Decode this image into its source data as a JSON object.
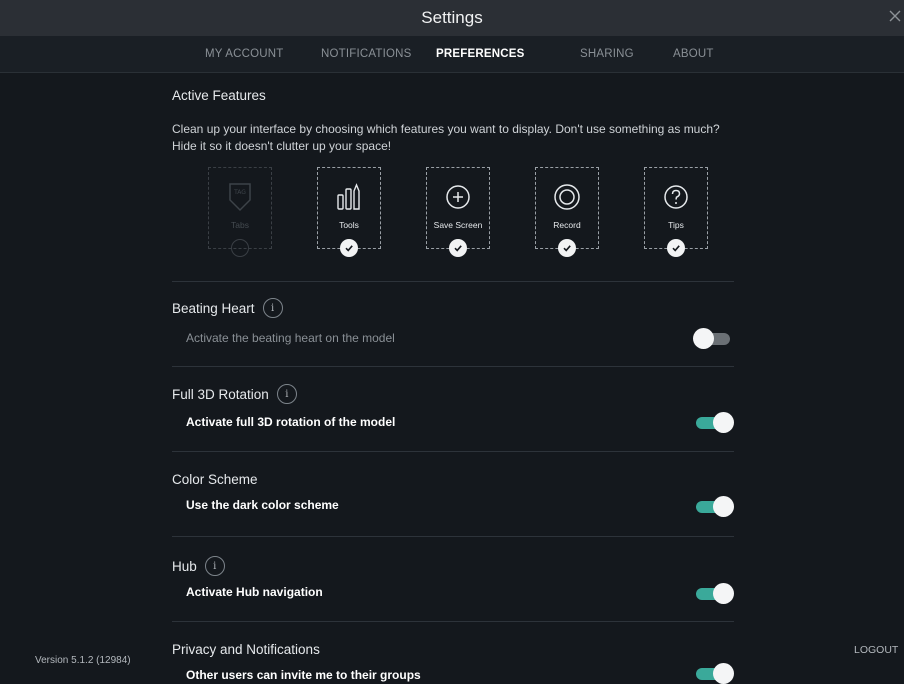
{
  "window": {
    "title": "Settings"
  },
  "tabs": [
    {
      "label": "MY ACCOUNT",
      "active": false
    },
    {
      "label": "NOTIFICATIONS",
      "active": false
    },
    {
      "label": "PREFERENCES",
      "active": true
    },
    {
      "label": "SHARING",
      "active": false
    },
    {
      "label": "ABOUT",
      "active": false
    }
  ],
  "active_features": {
    "title": "Active Features",
    "description": "Clean up your interface by choosing which features you want to display. Don't use something as much? Hide it so it doesn't clutter up your space!",
    "items": [
      {
        "label": "Tabs",
        "icon": "tag-icon",
        "enabled": false
      },
      {
        "label": "Tools",
        "icon": "tools-icon",
        "enabled": true
      },
      {
        "label": "Save Screen",
        "icon": "plus-circle-icon",
        "enabled": true
      },
      {
        "label": "Record",
        "icon": "record-icon",
        "enabled": true
      },
      {
        "label": "Tips",
        "icon": "question-icon",
        "enabled": true
      }
    ]
  },
  "settings": [
    {
      "title": "Beating Heart",
      "info": true,
      "subtitle": "Activate the beating heart on the model",
      "enabled": false
    },
    {
      "title": "Full 3D Rotation",
      "info": true,
      "subtitle": "Activate full 3D rotation of the model",
      "enabled": true
    },
    {
      "title": "Color Scheme",
      "info": false,
      "subtitle": "Use the dark color scheme",
      "enabled": true
    },
    {
      "title": "Hub",
      "info": true,
      "subtitle": "Activate Hub navigation",
      "enabled": true
    },
    {
      "title": "Privacy and Notifications",
      "info": false,
      "subtitle": "Other users can invite me to their groups",
      "enabled": true
    }
  ],
  "footer": {
    "version": "Version 5.1.2 (12984)",
    "logout": "LOGOUT"
  },
  "colors": {
    "background": "#14181d",
    "titlebar": "#2b2f35",
    "toggle_on": "#3aa99a",
    "toggle_off": "#6b7075"
  }
}
